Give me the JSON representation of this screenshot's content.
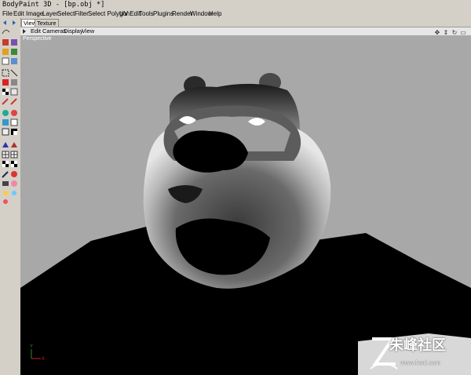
{
  "window": {
    "title": "BodyPaint 3D - [bp.obj *]"
  },
  "menubar": {
    "items": [
      "File",
      "Edit",
      "Image",
      "Layer",
      "Select",
      "Filter",
      "Select Polygon",
      "UV Edit",
      "Tools",
      "Plugins",
      "Render",
      "Window",
      "Help"
    ]
  },
  "tabs": [
    {
      "label": "View",
      "active": true
    },
    {
      "label": "Texture",
      "active": false
    }
  ],
  "view_menu": {
    "items": [
      "Edit",
      "Cameras",
      "Display",
      "View"
    ]
  },
  "viewport": {
    "label": "Perspective",
    "background": "#a8a8a8"
  },
  "watermark": {
    "cn": "朱峰社区",
    "url": "www.fxsd.com"
  },
  "toolbar_icons": [
    "undo-icon",
    "redo-icon",
    "brush-icon",
    "eraser-icon",
    "clone-icon",
    "smudge-icon",
    "fill-icon",
    "gradient-icon",
    "select-rect-icon",
    "select-lasso-icon",
    "move-icon",
    "scale-icon",
    "rotate-icon",
    "magic-wand-icon",
    "eyedropper-icon",
    "color-swatch-icon",
    "checker-icon",
    "grid-icon",
    "camera-icon",
    "light-icon"
  ]
}
